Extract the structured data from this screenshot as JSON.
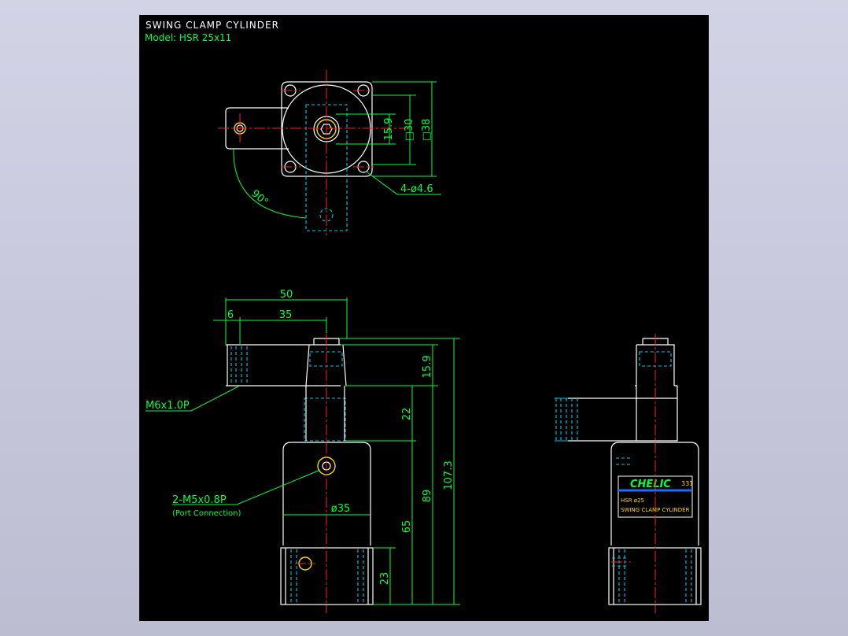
{
  "title": "SWING CLAMP CYLINDER",
  "model": "Model: HSR 25x11",
  "dims": {
    "d15_9": "15.9",
    "sq30": "□30",
    "sq38": "□38",
    "holes": "4-ø4.6",
    "angle": "90°",
    "w50": "50",
    "w6": "6",
    "w35": "35",
    "h15_9": "15.9",
    "h22": "22",
    "h107_3": "107.3",
    "h89": "89",
    "h65": "65",
    "h23": "23",
    "dia35": "ø35"
  },
  "callouts": {
    "thread": "M6x1.0P",
    "port": "2-M5x0.8P",
    "port_note": "(Port Connection)"
  },
  "label": {
    "brand": "CHELIC",
    "code": "331",
    "line1": "HSR ø25",
    "line2": "SWING CLAMP CYLINDER"
  },
  "colors": {
    "background": "#000000",
    "outline": "#ffffff",
    "hidden": "#00c8e6",
    "center": "#ff2020",
    "dimension": "#00ff3c",
    "highlight": "#ffd400",
    "label_blue": "#1e6bff"
  }
}
